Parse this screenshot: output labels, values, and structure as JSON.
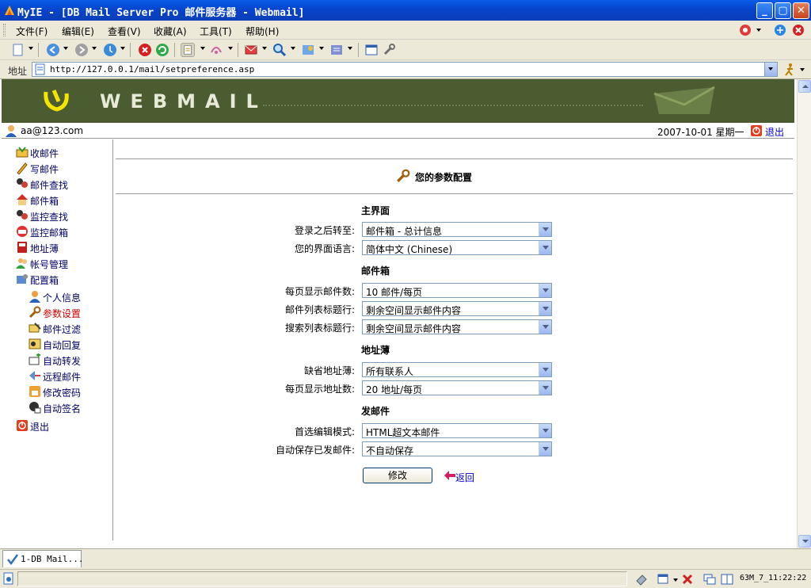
{
  "window": {
    "title": "MyIE - [DB Mail Server Pro 邮件服务器 - Webmail]",
    "minimize": "_",
    "restore": "▢",
    "close": "✕"
  },
  "menu": [
    "文件(F)",
    "编辑(E)",
    "查看(V)",
    "收藏(A)",
    "工具(T)",
    "帮助(H)"
  ],
  "address": {
    "label": "地址",
    "url": "http://127.0.0.1/mail/setpreference.asp"
  },
  "banner": {
    "wordmark": "WEBMAIL"
  },
  "userbar": {
    "user": "aa@123.com",
    "date": "2007-10-01 星期一",
    "logout": "退出"
  },
  "sidebar": {
    "items": [
      {
        "label": "收邮件",
        "icon": "inbox-icon"
      },
      {
        "label": "写邮件",
        "icon": "pencil-icon"
      },
      {
        "label": "邮件查找",
        "icon": "search-people-icon"
      },
      {
        "label": "邮件箱",
        "icon": "house-icon"
      },
      {
        "label": "监控查找",
        "icon": "search-people-icon"
      },
      {
        "label": "监控邮箱",
        "icon": "mailbox-icon"
      },
      {
        "label": "地址薄",
        "icon": "addressbook-icon"
      },
      {
        "label": "帐号管理",
        "icon": "users-icon"
      },
      {
        "label": "配置箱",
        "icon": "config-icon"
      }
    ],
    "subitems": [
      {
        "label": "个人信息",
        "icon": "person-icon"
      },
      {
        "label": "参数设置",
        "icon": "wrench-icon",
        "active": true
      },
      {
        "label": "邮件过滤",
        "icon": "filter-icon"
      },
      {
        "label": "自动回复",
        "icon": "reply-icon"
      },
      {
        "label": "自动转发",
        "icon": "forward-icon"
      },
      {
        "label": "远程邮件",
        "icon": "remote-icon"
      },
      {
        "label": "修改密码",
        "icon": "lock-icon"
      },
      {
        "label": "自动签名",
        "icon": "signature-icon"
      }
    ],
    "logout": "退出"
  },
  "main": {
    "title": "您的参数配置",
    "sections": {
      "ui": "主界面",
      "mailbox": "邮件箱",
      "addressbook": "地址薄",
      "send": "发邮件"
    },
    "fields": {
      "login_goto": {
        "label": "登录之后转至:",
        "value": "邮件箱 - 总计信息"
      },
      "language": {
        "label": "您的界面语言:",
        "value": "简体中文 (Chinese)"
      },
      "mails_per_page": {
        "label": "每页显示邮件数:",
        "value": "10 邮件/每页"
      },
      "list_subject": {
        "label": "邮件列表标题行:",
        "value": "剩余空间显示邮件内容"
      },
      "search_subject": {
        "label": "搜索列表标题行:",
        "value": "剩余空间显示邮件内容"
      },
      "default_addressbook": {
        "label": "缺省地址薄:",
        "value": "所有联系人"
      },
      "addresses_per_page": {
        "label": "每页显示地址数:",
        "value": "20 地址/每页"
      },
      "edit_mode": {
        "label": "首选编辑模式:",
        "value": "HTML超文本邮件"
      },
      "autosave": {
        "label": "自动保存已发邮件:",
        "value": "不自动保存"
      }
    },
    "modify_button": "修改",
    "back_link": "返回"
  },
  "tab": {
    "label": "1-DB Mail..."
  },
  "status": {
    "clock": "63M_7_11:22:22"
  }
}
